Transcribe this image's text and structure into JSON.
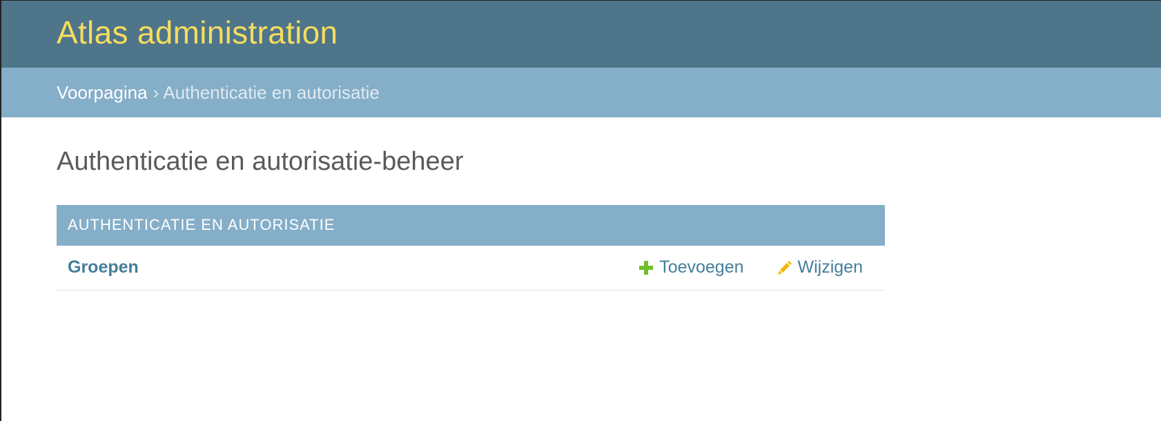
{
  "header": {
    "site_title": "Atlas administration"
  },
  "breadcrumbs": {
    "home_label": "Voorpagina",
    "separator": "›",
    "current_label": "Authenticatie en autorisatie"
  },
  "main": {
    "page_title": "Authenticatie en autorisatie-beheer",
    "module": {
      "caption": "AUTHENTICATIE EN AUTORISATIE",
      "rows": [
        {
          "model_label": "Groepen",
          "add_label": "Toevoegen",
          "change_label": "Wijzigen"
        }
      ]
    }
  },
  "colors": {
    "header_bg": "#4f758b",
    "brand_text": "#f5dd5d",
    "breadcrumb_bg": "#85aec8",
    "link": "#447e9b",
    "add_icon": "#70bf2b",
    "change_icon": "#efb80b"
  },
  "icons": {
    "add": "plus-icon",
    "change": "pencil-icon"
  }
}
